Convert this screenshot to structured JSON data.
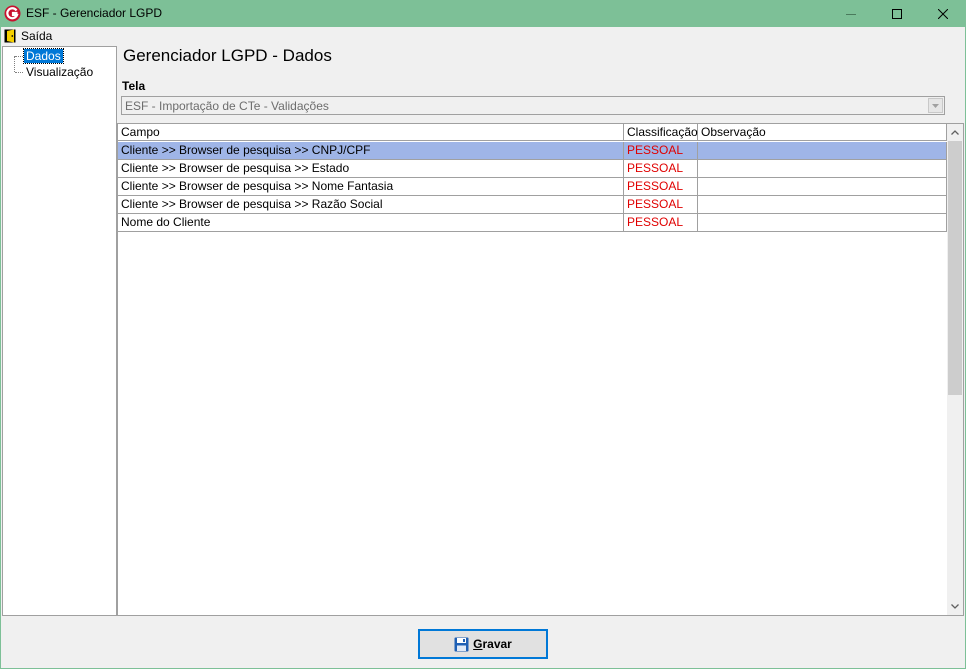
{
  "window": {
    "title": "ESF - Gerenciador LGPD",
    "icon": "esf-logo-icon",
    "accent": "#7dc097"
  },
  "menu": {
    "exit_label": "Saída",
    "exit_icon": "door-exit-icon"
  },
  "tree": {
    "items": [
      {
        "label": "Dados",
        "selected": true
      },
      {
        "label": "Visualização",
        "selected": false
      }
    ]
  },
  "page": {
    "title": "Gerenciador LGPD - Dados",
    "tela_label": "Tela",
    "tela_value": "ESF - Importação de CTe - Validações"
  },
  "grid": {
    "columns": [
      "Campo",
      "Classificação",
      "Observação"
    ],
    "rows": [
      {
        "campo": "Cliente >> Browser de pesquisa >> CNPJ/CPF",
        "classificacao": "PESSOAL",
        "observacao": "",
        "selected": true
      },
      {
        "campo": "Cliente >> Browser de pesquisa >> Estado",
        "classificacao": "PESSOAL",
        "observacao": "",
        "selected": false
      },
      {
        "campo": "Cliente >> Browser de pesquisa >> Nome Fantasia",
        "classificacao": "PESSOAL",
        "observacao": "",
        "selected": false
      },
      {
        "campo": "Cliente >> Browser de pesquisa >> Razão Social",
        "classificacao": "PESSOAL",
        "observacao": "",
        "selected": false
      },
      {
        "campo": "Nome do Cliente",
        "classificacao": "PESSOAL",
        "observacao": "",
        "selected": false
      }
    ],
    "classification_color": "#e00000",
    "selected_row_color": "#9fb5e7"
  },
  "footer": {
    "save_label_mnemonic": "G",
    "save_label_rest": "ravar",
    "save_icon": "floppy-disk-icon"
  }
}
